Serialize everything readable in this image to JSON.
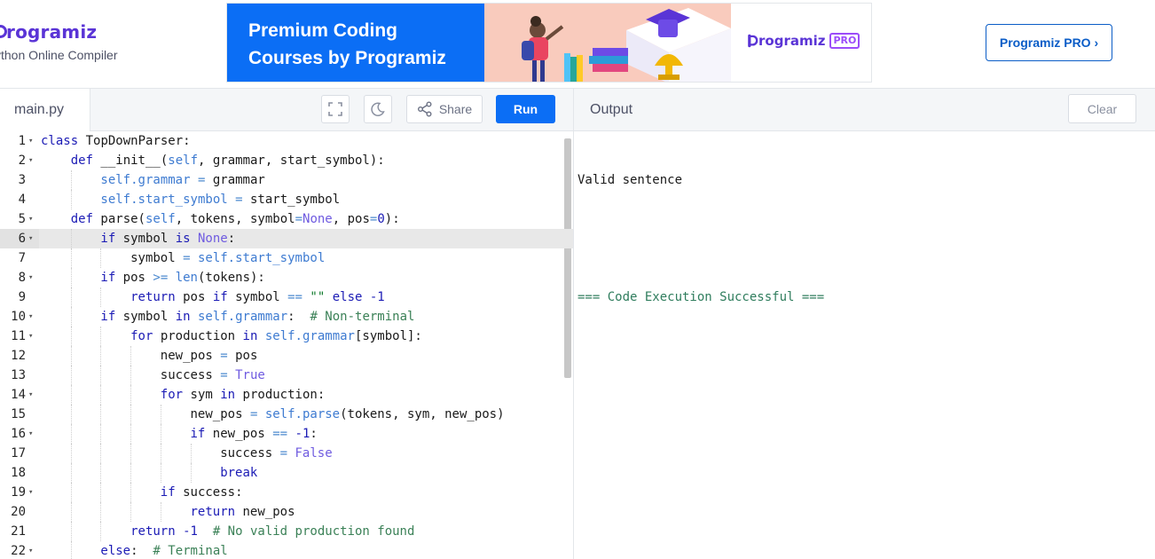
{
  "header": {
    "logo_text": "rogramiz",
    "subtitle": "ython Online Compiler",
    "banner": {
      "line1": "Premium Coding",
      "line2": "Courses by Programiz",
      "pro_logo": "rogramiz",
      "pro_badge": "PRO"
    },
    "pro_button": "Programiz PRO ›"
  },
  "toolbar": {
    "file_tab": "main.py",
    "fullscreen_icon": "fullscreen-icon",
    "theme_icon": "moon-icon",
    "share_label": "Share",
    "run_label": "Run",
    "output_label": "Output",
    "clear_label": "Clear"
  },
  "editor": {
    "active_line": 6,
    "lines": [
      {
        "n": "1",
        "fold": true,
        "indent": 0,
        "tokens": [
          [
            "kw",
            "class"
          ],
          [
            "fn",
            " TopDownParser:"
          ]
        ]
      },
      {
        "n": "2",
        "fold": true,
        "indent": 1,
        "tokens": [
          [
            "kw",
            "def"
          ],
          [
            "fn",
            " __init__("
          ],
          [
            "self",
            "self"
          ],
          [
            "fn",
            ", grammar, start_symbol):"
          ]
        ]
      },
      {
        "n": "3",
        "fold": false,
        "indent": 2,
        "tokens": [
          [
            "self",
            "self"
          ],
          [
            "self",
            ".grammar"
          ],
          [
            "op",
            " = "
          ],
          [
            "fn",
            "grammar"
          ]
        ]
      },
      {
        "n": "4",
        "fold": false,
        "indent": 2,
        "tokens": [
          [
            "self",
            "self"
          ],
          [
            "self",
            ".start_symbol"
          ],
          [
            "op",
            " = "
          ],
          [
            "fn",
            "start_symbol"
          ]
        ]
      },
      {
        "n": "5",
        "fold": true,
        "indent": 1,
        "tokens": [
          [
            "kw",
            "def"
          ],
          [
            "fn",
            " parse("
          ],
          [
            "self",
            "self"
          ],
          [
            "fn",
            ", tokens, symbol"
          ],
          [
            "op",
            "="
          ],
          [
            "const",
            "None"
          ],
          [
            "fn",
            ", pos"
          ],
          [
            "op",
            "="
          ],
          [
            "num",
            "0"
          ],
          [
            "fn",
            "):"
          ]
        ]
      },
      {
        "n": "6",
        "fold": true,
        "indent": 2,
        "tokens": [
          [
            "kw",
            "if"
          ],
          [
            "fn",
            " symbol "
          ],
          [
            "kw",
            "is"
          ],
          [
            "fn",
            " "
          ],
          [
            "const",
            "None"
          ],
          [
            "fn",
            ":"
          ]
        ]
      },
      {
        "n": "7",
        "fold": false,
        "indent": 3,
        "tokens": [
          [
            "fn",
            "symbol "
          ],
          [
            "op",
            "= "
          ],
          [
            "self",
            "self.start_symbol"
          ]
        ]
      },
      {
        "n": "8",
        "fold": true,
        "indent": 2,
        "tokens": [
          [
            "kw",
            "if"
          ],
          [
            "fn",
            " pos "
          ],
          [
            "op",
            ">="
          ],
          [
            "fn",
            " "
          ],
          [
            "self",
            "len"
          ],
          [
            "fn",
            "(tokens):"
          ]
        ]
      },
      {
        "n": "9",
        "fold": false,
        "indent": 3,
        "tokens": [
          [
            "kw",
            "return"
          ],
          [
            "fn",
            " pos "
          ],
          [
            "kw",
            "if"
          ],
          [
            "fn",
            " symbol "
          ],
          [
            "op",
            "=="
          ],
          [
            "fn",
            " "
          ],
          [
            "str",
            "\"\""
          ],
          [
            "fn",
            " "
          ],
          [
            "kw",
            "else"
          ],
          [
            "fn",
            " "
          ],
          [
            "num",
            "-1"
          ]
        ]
      },
      {
        "n": "10",
        "fold": true,
        "indent": 2,
        "tokens": [
          [
            "kw",
            "if"
          ],
          [
            "fn",
            " symbol "
          ],
          [
            "kw",
            "in"
          ],
          [
            "fn",
            " "
          ],
          [
            "self",
            "self.grammar"
          ],
          [
            "fn",
            ":  "
          ],
          [
            "cmt",
            "# Non-terminal"
          ]
        ]
      },
      {
        "n": "11",
        "fold": true,
        "indent": 3,
        "tokens": [
          [
            "kw",
            "for"
          ],
          [
            "fn",
            " production "
          ],
          [
            "kw",
            "in"
          ],
          [
            "fn",
            " "
          ],
          [
            "self",
            "self.grammar"
          ],
          [
            "fn",
            "[symbol]:"
          ]
        ]
      },
      {
        "n": "12",
        "fold": false,
        "indent": 4,
        "tokens": [
          [
            "fn",
            "new_pos "
          ],
          [
            "op",
            "="
          ],
          [
            "fn",
            " pos"
          ]
        ]
      },
      {
        "n": "13",
        "fold": false,
        "indent": 4,
        "tokens": [
          [
            "fn",
            "success "
          ],
          [
            "op",
            "="
          ],
          [
            "fn",
            " "
          ],
          [
            "const",
            "True"
          ]
        ]
      },
      {
        "n": "14",
        "fold": true,
        "indent": 4,
        "tokens": [
          [
            "kw",
            "for"
          ],
          [
            "fn",
            " sym "
          ],
          [
            "kw",
            "in"
          ],
          [
            "fn",
            " production:"
          ]
        ]
      },
      {
        "n": "15",
        "fold": false,
        "indent": 5,
        "tokens": [
          [
            "fn",
            "new_pos "
          ],
          [
            "op",
            "="
          ],
          [
            "fn",
            " "
          ],
          [
            "self",
            "self.parse"
          ],
          [
            "fn",
            "(tokens, sym, new_pos)"
          ]
        ]
      },
      {
        "n": "16",
        "fold": true,
        "indent": 5,
        "tokens": [
          [
            "kw",
            "if"
          ],
          [
            "fn",
            " new_pos "
          ],
          [
            "op",
            "=="
          ],
          [
            "fn",
            " "
          ],
          [
            "num",
            "-1"
          ],
          [
            "fn",
            ":"
          ]
        ]
      },
      {
        "n": "17",
        "fold": false,
        "indent": 6,
        "tokens": [
          [
            "fn",
            "success "
          ],
          [
            "op",
            "="
          ],
          [
            "fn",
            " "
          ],
          [
            "const",
            "False"
          ]
        ]
      },
      {
        "n": "18",
        "fold": false,
        "indent": 6,
        "tokens": [
          [
            "kw",
            "break"
          ]
        ]
      },
      {
        "n": "19",
        "fold": true,
        "indent": 4,
        "tokens": [
          [
            "kw",
            "if"
          ],
          [
            "fn",
            " success:"
          ]
        ]
      },
      {
        "n": "20",
        "fold": false,
        "indent": 5,
        "tokens": [
          [
            "kw",
            "return"
          ],
          [
            "fn",
            " new_pos"
          ]
        ]
      },
      {
        "n": "21",
        "fold": false,
        "indent": 3,
        "tokens": [
          [
            "kw",
            "return"
          ],
          [
            "fn",
            " "
          ],
          [
            "num",
            "-1"
          ],
          [
            "fn",
            "  "
          ],
          [
            "cmt",
            "# No valid production found"
          ]
        ]
      },
      {
        "n": "22",
        "fold": true,
        "indent": 2,
        "tokens": [
          [
            "kw",
            "else"
          ],
          [
            "fn",
            ":  "
          ],
          [
            "cmt",
            "# Terminal"
          ]
        ]
      }
    ]
  },
  "output": {
    "line1": "Valid sentence",
    "line2": "",
    "line3": "=== Code Execution Successful ==="
  }
}
